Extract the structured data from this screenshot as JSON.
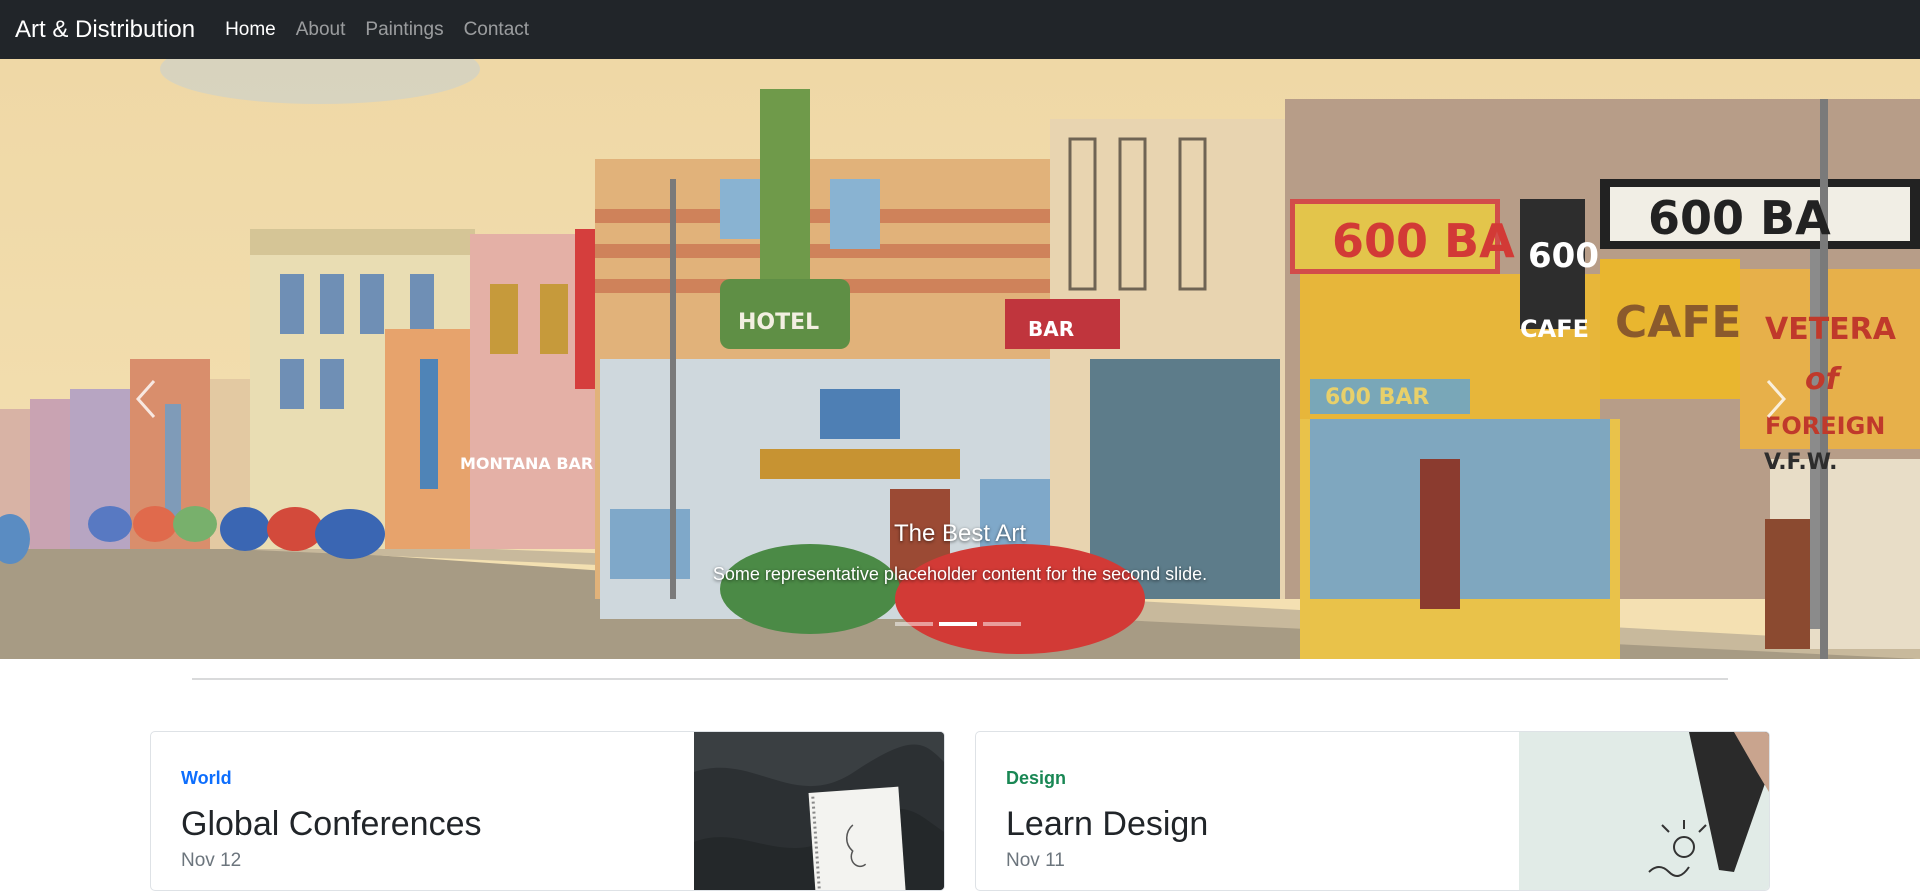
{
  "navbar": {
    "brand": "Art & Distribution",
    "links": [
      {
        "label": "Home",
        "active": true
      },
      {
        "label": "About",
        "active": false
      },
      {
        "label": "Paintings",
        "active": false
      },
      {
        "label": "Contact",
        "active": false
      }
    ]
  },
  "carousel": {
    "caption_title": "The Best Art",
    "caption_text": "Some representative placeholder content for the second slide.",
    "slide_count": 3,
    "active_slide": 2,
    "signage": {
      "hotel": "HOTEL",
      "sign_600_bar": "600 BA",
      "sign_600": "600",
      "cafe": "CAFE",
      "bar": "BAR",
      "montana_bar": "MONTANA BAR",
      "sign_600_bar_lower": "600 BAR",
      "cafe_big": "CAFE",
      "veterans": "VETERA",
      "of": "of",
      "foreign": "FOREIGN",
      "vfw": "V.F.W.",
      "sign_600_right": "600 BA"
    }
  },
  "cards": [
    {
      "category": "World",
      "category_color": "#0d6efd",
      "title": "Global Conferences",
      "date": "Nov 12"
    },
    {
      "category": "Design",
      "category_color": "#198754",
      "title": "Learn Design",
      "date": "Nov 11"
    }
  ],
  "colors": {
    "navbar_bg": "#212529",
    "divider": "#d9dadb"
  },
  "icons": {
    "prev": "chevron-left-icon",
    "next": "chevron-right-icon"
  }
}
